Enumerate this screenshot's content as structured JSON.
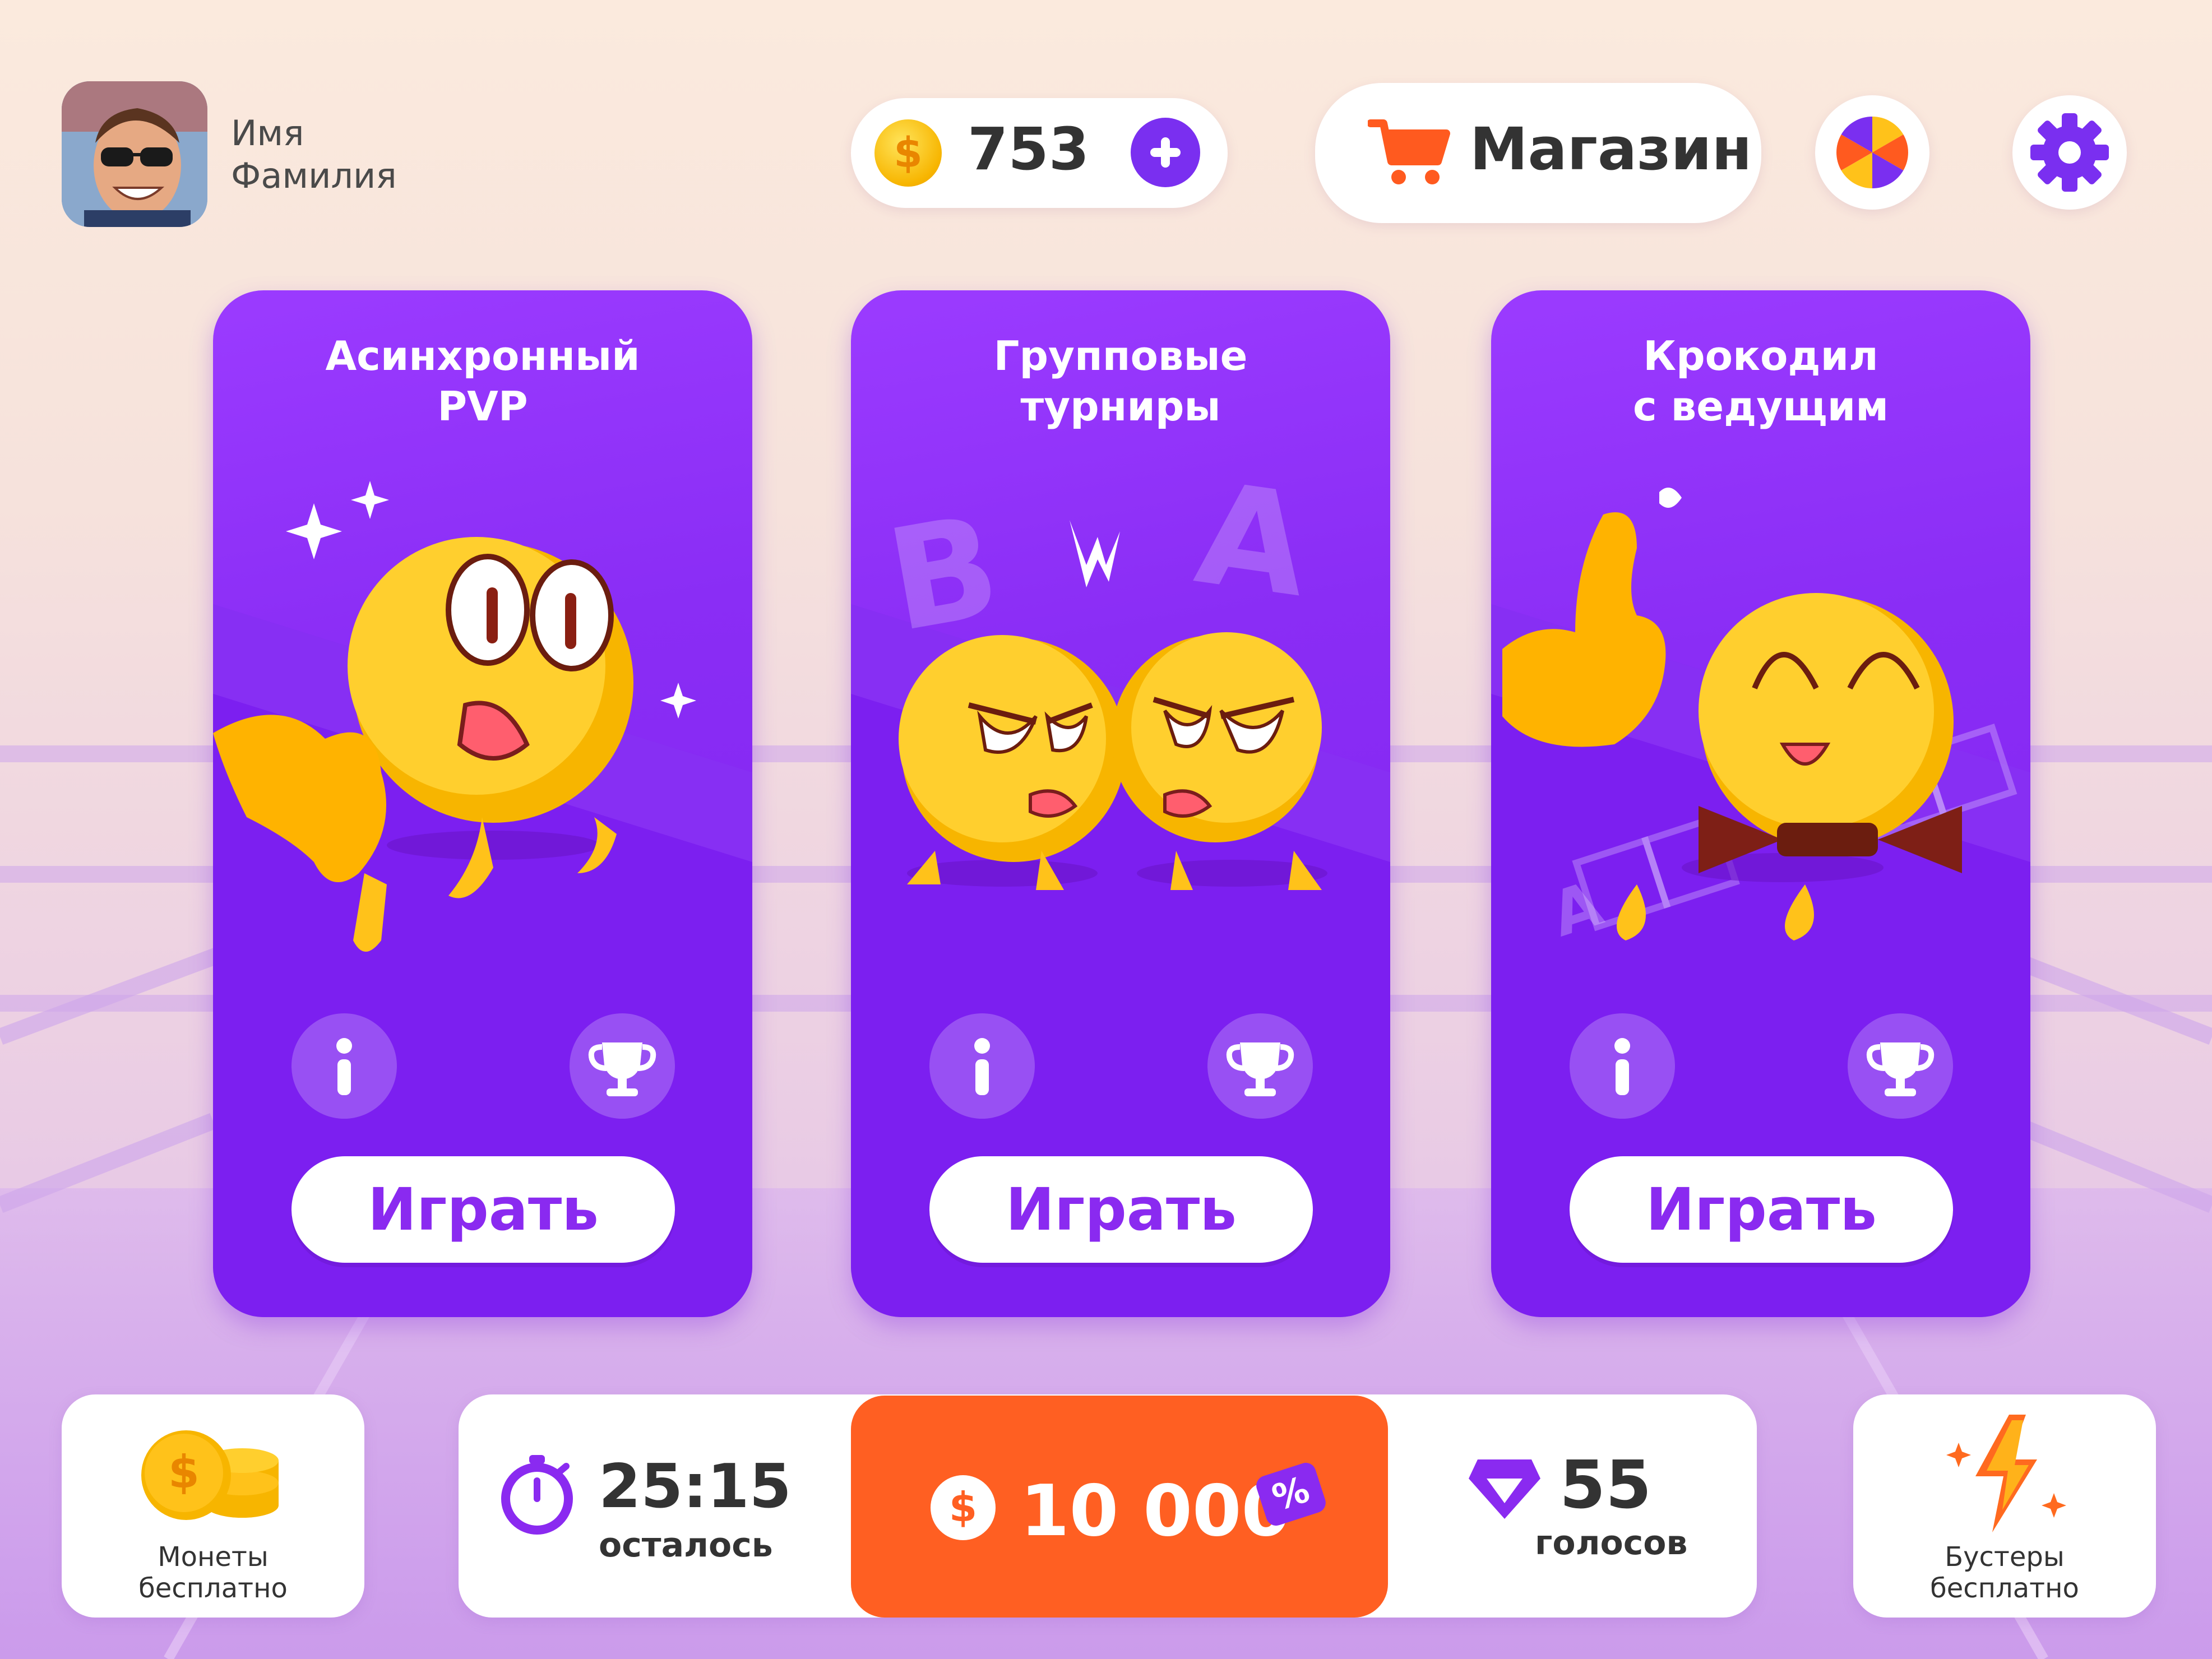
{
  "user": {
    "first_name": "Имя",
    "last_name": "Фамилия"
  },
  "currency": {
    "symbol": "$",
    "value": "753"
  },
  "shop": {
    "label": "Магазин"
  },
  "cards": [
    {
      "title_line1": "Асинхронный",
      "title_line2": "PVP",
      "play_label": "Играть"
    },
    {
      "title_line1": "Групповые",
      "title_line2": "турниры",
      "play_label": "Играть",
      "letter_a": "A",
      "letter_b": "B"
    },
    {
      "title_line1": "Крокодил",
      "title_line2": "с ведущим",
      "play_label": "Играть",
      "tile_letter": "A"
    }
  ],
  "bottom": {
    "coins_free_line1": "Монеты",
    "coins_free_line2": "бесплатно",
    "timer_value": "25:15",
    "timer_label": "осталось",
    "prize_symbol": "$",
    "prize_value": "10 000",
    "prize_badge": "%",
    "votes_value": "55",
    "votes_label": "голосов",
    "boosters_line1": "Бустеры",
    "boosters_line2": "бесплатно"
  },
  "colors": {
    "accent_purple": "#7a2ff0",
    "card_purple": "#8a2df5",
    "prize_orange": "#ff5f22",
    "shop_cart_orange": "#ff5a1f",
    "coin_yellow": "#f7b500"
  },
  "icons": [
    "coin-icon",
    "plus-icon",
    "cart-icon",
    "wheel-icon",
    "gear-icon",
    "info-icon",
    "trophy-icon",
    "stopwatch-icon",
    "gem-icon",
    "lightning-icon",
    "coin-stack-icon"
  ]
}
